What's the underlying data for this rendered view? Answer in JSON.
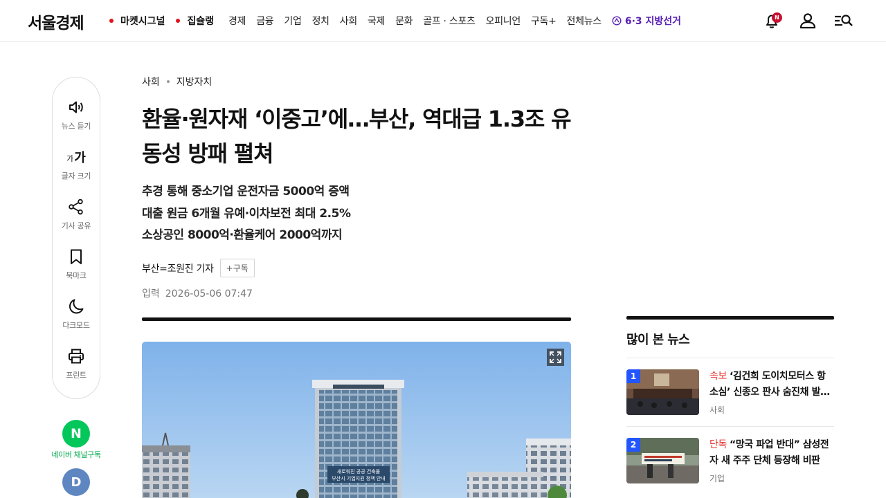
{
  "header": {
    "logo": "서울경제",
    "hot_items": [
      "마켓시그널",
      "집슐랭"
    ],
    "nav_items": [
      "경제",
      "금융",
      "기업",
      "정치",
      "사회",
      "국제",
      "문화",
      "골프 · 스포츠",
      "오피니언",
      "구독+",
      "전체뉴스"
    ],
    "special": "6·3 지방선거",
    "bell_badge": "N",
    "icons": [
      "bell-icon",
      "user-icon",
      "menu-search-icon"
    ],
    "accent_color": "#5b23b5"
  },
  "toolbar": {
    "items": [
      {
        "label": "뉴스 듣기",
        "icon": "speaker-icon"
      },
      {
        "label": "글자 크기",
        "icon": "font-size-icon",
        "glyph_small": "가",
        "glyph_big": "가"
      },
      {
        "label": "기사 공유",
        "icon": "share-icon"
      },
      {
        "label": "북마크",
        "icon": "bookmark-icon"
      },
      {
        "label": "다크모드",
        "icon": "moon-icon"
      },
      {
        "label": "프린트",
        "icon": "printer-icon"
      }
    ]
  },
  "channels": {
    "naver_glyph": "N",
    "naver_label": "네이버 채널구독",
    "daum_glyph": "D"
  },
  "article": {
    "breadcrumb": [
      "사회",
      "지방자치"
    ],
    "headline": "환율·원자재 ‘이중고’에…부산, 역대급 1.3조 유동성 방패 펼쳐",
    "subheads": [
      "추경 통해 중소기업 운전자금 5000억 증액",
      "대출 원금 6개월 유예·이차보전 최대 2.5%",
      "소상공인 8000억·환율케어 2000억까지"
    ],
    "reporter": "부산=조원진 기자",
    "subscribe_label": "+구독",
    "date_label": "입력",
    "date": "2026-05-06 07:47",
    "photo_banner": [
      "새로워진 공공 건축물",
      "부산시 기업지원 정책 안내"
    ]
  },
  "popular": {
    "title": "많이 본 뉴스",
    "items": [
      {
        "rank": "1",
        "tag": "속보",
        "title": "‘김건희 도이치모터스 항소심’ 신종오 판사 숨진채 발…",
        "category": "사회"
      },
      {
        "rank": "2",
        "tag": "단독",
        "title": "“망국 파업 반대” 삼성전자 새 주주 단체 등장해 비판",
        "category": "기업"
      }
    ],
    "rank_color": "#2356ff",
    "tag_color": "#e5322d"
  }
}
